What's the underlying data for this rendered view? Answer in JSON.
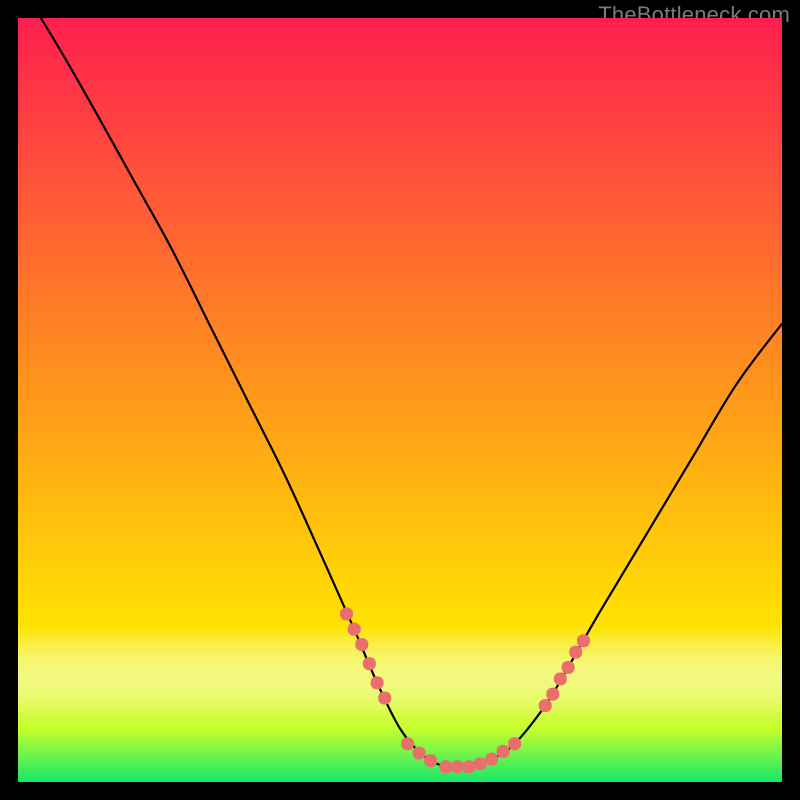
{
  "watermark": {
    "text": "TheBottleneck.com",
    "style": "color:#7b7b7b"
  },
  "colors": {
    "top": "#ff1f50",
    "mid": "#ffe400",
    "bottom": "#16e86b",
    "dot": "#e86f6c",
    "curve": "#000000"
  },
  "chart_data": {
    "type": "line",
    "title": "",
    "xlabel": "",
    "ylabel": "",
    "xlim": [
      0,
      100
    ],
    "ylim": [
      0,
      100
    ],
    "curve": [
      {
        "x": 3,
        "y": 100
      },
      {
        "x": 6,
        "y": 95
      },
      {
        "x": 10,
        "y": 88
      },
      {
        "x": 15,
        "y": 79
      },
      {
        "x": 20,
        "y": 70
      },
      {
        "x": 25,
        "y": 60
      },
      {
        "x": 30,
        "y": 50
      },
      {
        "x": 35,
        "y": 40
      },
      {
        "x": 40,
        "y": 29
      },
      {
        "x": 44,
        "y": 20
      },
      {
        "x": 47,
        "y": 13
      },
      {
        "x": 50,
        "y": 7
      },
      {
        "x": 53,
        "y": 3.5
      },
      {
        "x": 56,
        "y": 2
      },
      {
        "x": 59,
        "y": 2
      },
      {
        "x": 62,
        "y": 3
      },
      {
        "x": 65,
        "y": 5
      },
      {
        "x": 69,
        "y": 10
      },
      {
        "x": 72,
        "y": 15
      },
      {
        "x": 76,
        "y": 22
      },
      {
        "x": 82,
        "y": 32
      },
      {
        "x": 88,
        "y": 42
      },
      {
        "x": 94,
        "y": 52
      },
      {
        "x": 100,
        "y": 60
      }
    ],
    "dots": [
      {
        "x": 43,
        "y": 22
      },
      {
        "x": 44,
        "y": 20
      },
      {
        "x": 45,
        "y": 18
      },
      {
        "x": 46,
        "y": 15.5
      },
      {
        "x": 47,
        "y": 13
      },
      {
        "x": 48,
        "y": 11
      },
      {
        "x": 51,
        "y": 5
      },
      {
        "x": 52.5,
        "y": 3.8
      },
      {
        "x": 54,
        "y": 2.8
      },
      {
        "x": 56,
        "y": 2
      },
      {
        "x": 57.5,
        "y": 2
      },
      {
        "x": 59,
        "y": 2
      },
      {
        "x": 60.5,
        "y": 2.4
      },
      {
        "x": 62,
        "y": 3
      },
      {
        "x": 63.5,
        "y": 4
      },
      {
        "x": 65,
        "y": 5
      },
      {
        "x": 69,
        "y": 10
      },
      {
        "x": 70,
        "y": 11.5
      },
      {
        "x": 71,
        "y": 13.5
      },
      {
        "x": 72,
        "y": 15
      },
      {
        "x": 73,
        "y": 17
      },
      {
        "x": 74,
        "y": 18.5
      }
    ]
  }
}
